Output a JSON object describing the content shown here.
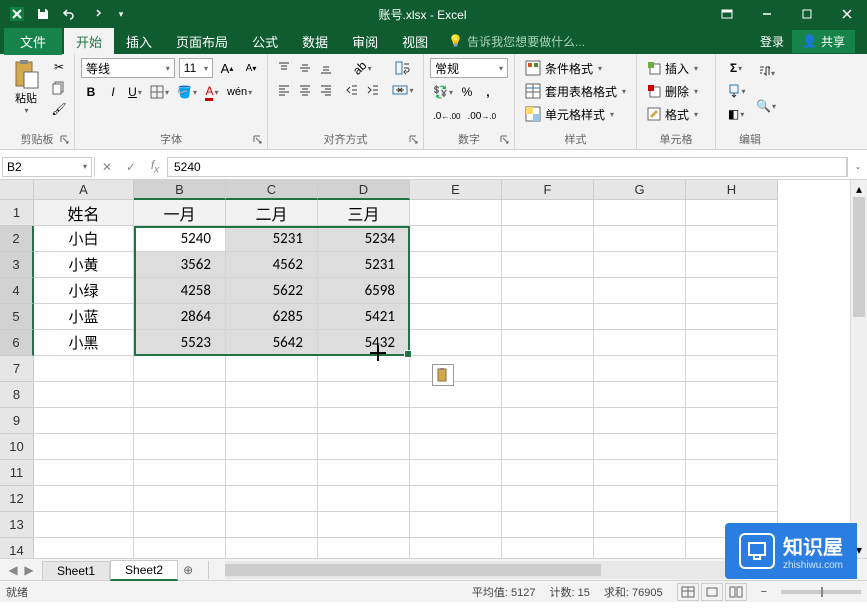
{
  "title": "账号.xlsx - Excel",
  "ribbon_tabs": {
    "file": "文件",
    "home": "开始",
    "insert": "插入",
    "page_layout": "页面布局",
    "formulas": "公式",
    "data": "数据",
    "review": "审阅",
    "view": "视图",
    "tell_me": "告诉我您想要做什么...",
    "signin": "登录",
    "share": "共享"
  },
  "ribbon": {
    "clipboard": {
      "label": "剪贴板",
      "paste": "粘贴"
    },
    "font": {
      "label": "字体",
      "name": "等线",
      "size": "11"
    },
    "alignment": {
      "label": "对齐方式"
    },
    "number": {
      "label": "数字",
      "format": "常规"
    },
    "styles": {
      "label": "样式",
      "cond_fmt": "条件格式",
      "table_fmt": "套用表格格式",
      "cell_styles": "单元格样式"
    },
    "cells": {
      "label": "单元格",
      "insert": "插入",
      "delete": "删除",
      "format": "格式"
    },
    "editing": {
      "label": "编辑"
    }
  },
  "formula_bar": {
    "name_box": "B2",
    "formula": "5240"
  },
  "columns": [
    "A",
    "B",
    "C",
    "D",
    "E",
    "F",
    "G",
    "H"
  ],
  "rows": [
    "1",
    "2",
    "3",
    "4",
    "5",
    "6",
    "7",
    "8",
    "9",
    "10",
    "11",
    "12",
    "13",
    "14"
  ],
  "headers": {
    "A": "姓名",
    "B": "一月",
    "C": "二月",
    "D": "三月"
  },
  "data": [
    {
      "name": "小白",
      "b": "5240",
      "c": "5231",
      "d": "5234"
    },
    {
      "name": "小黄",
      "b": "3562",
      "c": "4562",
      "d": "5231"
    },
    {
      "name": "小绿",
      "b": "4258",
      "c": "5622",
      "d": "6598"
    },
    {
      "name": "小蓝",
      "b": "2864",
      "c": "6285",
      "d": "5421"
    },
    {
      "name": "小黑",
      "b": "5523",
      "c": "5642",
      "d": "5432"
    }
  ],
  "chart_data": {
    "type": "table",
    "title": "账号",
    "columns": [
      "姓名",
      "一月",
      "二月",
      "三月"
    ],
    "rows": [
      [
        "小白",
        5240,
        5231,
        5234
      ],
      [
        "小黄",
        3562,
        4562,
        5231
      ],
      [
        "小绿",
        4258,
        5622,
        6598
      ],
      [
        "小蓝",
        2864,
        6285,
        5421
      ],
      [
        "小黑",
        5523,
        5642,
        5432
      ]
    ]
  },
  "sheets": {
    "s1": "Sheet1",
    "s2": "Sheet2"
  },
  "status": {
    "ready": "就绪",
    "avg_label": "平均值:",
    "avg": "5127",
    "count_label": "计数:",
    "count": "15",
    "sum_label": "求和:",
    "sum": "76905"
  },
  "watermark": {
    "name": "知识屋",
    "url": "zhishiwu.com"
  }
}
